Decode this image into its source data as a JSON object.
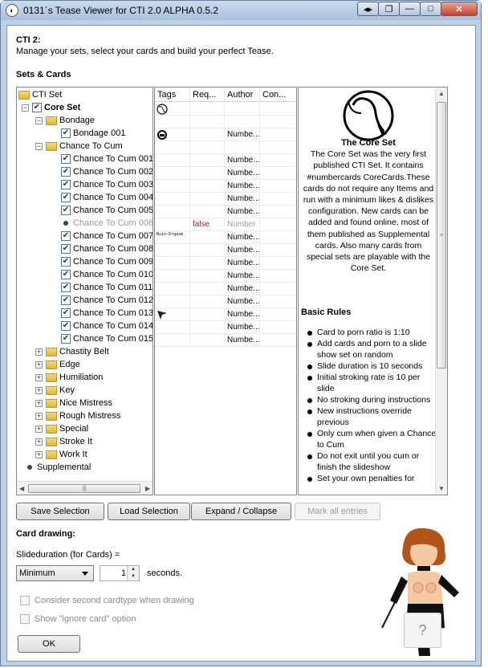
{
  "window": {
    "title": "0131´s Tease Viewer for CTI 2.0 ALPHA 0.5.2"
  },
  "header": {
    "title": "CTI 2:",
    "subtitle": "Manage your sets, select your cards and build your perfect Tease."
  },
  "sets_section": {
    "title": "Sets & Cards"
  },
  "tree": [
    {
      "label": "CTI Set"
    },
    {
      "label": "Core Set"
    },
    {
      "label": "Bondage"
    },
    {
      "label": "Bondage 001"
    },
    {
      "label": "Chance To Cum"
    },
    {
      "label": "Chance To Cum 001"
    },
    {
      "label": "Chance To Cum 002"
    },
    {
      "label": "Chance To Cum 003"
    },
    {
      "label": "Chance To Cum 004"
    },
    {
      "label": "Chance To Cum 005"
    },
    {
      "label": "Chance To Cum 006"
    },
    {
      "label": "Chance To Cum 007"
    },
    {
      "label": "Chance To Cum 008"
    },
    {
      "label": "Chance To Cum 009"
    },
    {
      "label": "Chance To Cum 010"
    },
    {
      "label": "Chance To Cum 011"
    },
    {
      "label": "Chance To Cum 012"
    },
    {
      "label": "Chance To Cum 013"
    },
    {
      "label": "Chance To Cum 014"
    },
    {
      "label": "Chance To Cum 015"
    },
    {
      "label": "Chastity Belt"
    },
    {
      "label": "Edge"
    },
    {
      "label": "Humiliation"
    },
    {
      "label": "Key"
    },
    {
      "label": "Nice Mistress"
    },
    {
      "label": "Rough Mistress"
    },
    {
      "label": "Special"
    },
    {
      "label": "Stroke It"
    },
    {
      "label": "Work It"
    },
    {
      "label": "Supplemental"
    }
  ],
  "grid": {
    "columns": [
      "Tags",
      "Req...",
      "Author",
      "Con..."
    ],
    "rows": [
      {
        "tag_icon": "coreset-icon",
        "req": "",
        "author": ""
      },
      {
        "tag_icon": "",
        "req": "",
        "author": ""
      },
      {
        "tag_icon": "bondage-tag-icon",
        "req": "",
        "author": "Numbe..."
      },
      {
        "tag_icon": "",
        "req": "",
        "author": ""
      },
      {
        "tag_icon": "",
        "req": "",
        "author": "Numbe..."
      },
      {
        "tag_icon": "",
        "req": "",
        "author": "Numbe..."
      },
      {
        "tag_icon": "",
        "req": "",
        "author": "Numbe..."
      },
      {
        "tag_icon": "",
        "req": "",
        "author": "Numbe..."
      },
      {
        "tag_icon": "",
        "req": "",
        "author": "Numbe..."
      },
      {
        "tag_icon": "",
        "req": "false",
        "author": "Number"
      },
      {
        "tag_icon": "ruin-orgasm-tag",
        "tag_text": "Ruin-Orgasm",
        "req": "",
        "author": "Numbe..."
      },
      {
        "tag_icon": "",
        "req": "",
        "author": "Numbe..."
      },
      {
        "tag_icon": "",
        "req": "",
        "author": "Numbe..."
      },
      {
        "tag_icon": "",
        "req": "",
        "author": "Numbe..."
      },
      {
        "tag_icon": "",
        "req": "",
        "author": "Numbe..."
      },
      {
        "tag_icon": "",
        "req": "",
        "author": "Numbe..."
      },
      {
        "tag_icon": "arrow-tag-icon",
        "req": "",
        "author": "Numbe..."
      },
      {
        "tag_icon": "",
        "req": "",
        "author": "Numbe..."
      },
      {
        "tag_icon": "",
        "req": "",
        "author": "Numbe..."
      }
    ]
  },
  "info": {
    "set_title": "The Core Set",
    "description": "The Core Set was the very first published CTI Set. It contains #numbercards CoreCards.These cards do not require any Items and run with a minimum likes & dislikes configuration. New cards can be added and found online, most of them published as Supplemental cards. Also many cards from special sets are playable with the Core Set.",
    "rules_title": "Basic Rules",
    "rules": [
      "Card to porn ratio is 1:10",
      "Add cards and porn to a slide show set on random",
      "Slide duration is 10 seconds",
      "Initial stroking rate is 10 per slide",
      "No stroking during instructions",
      "New instructions override previous",
      "Only cum when given a Chance to Cum",
      "Do not exit until you cum or finish the slideshow",
      "Set your own penalties for"
    ]
  },
  "buttons": {
    "save": "Save Selection",
    "load": "Load Selection",
    "expand": "Expand / Collapse",
    "mark_all": "Mark all entries",
    "ok": "OK",
    "help": "?"
  },
  "card_drawing": {
    "title": "Card drawing:",
    "slideduration_label": "Slideduration (for Cards) =",
    "mode": "Minimum",
    "seconds_value": "1",
    "seconds_label": "seconds.",
    "option_second_cardtype": "Consider second cardtype when drawing",
    "option_ignore_card": "Show \"ignore card\" option"
  },
  "colors": {
    "title_bar": "#bcd0e8",
    "false_text": "#b01818"
  }
}
